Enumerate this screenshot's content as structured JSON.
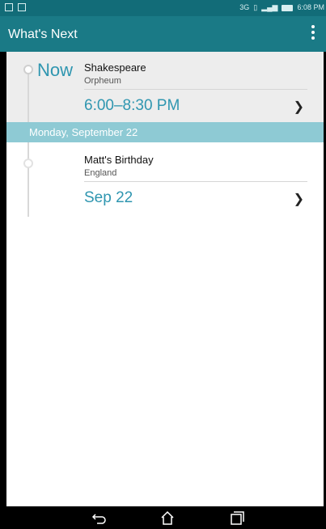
{
  "status_bar": {
    "left_icons": [
      "qs",
      "cc"
    ],
    "time": "6:08 PM"
  },
  "app_bar": {
    "title": "What's Next",
    "overflow_icon": "more-vert-icon"
  },
  "now_section": {
    "label": "Now",
    "event": {
      "title": "Shakespeare",
      "subtitle": "Orpheum",
      "time": "6:00–8:30 PM"
    }
  },
  "day_header": "Monday, September 22",
  "day_events": [
    {
      "title": "Matt's Birthday",
      "subtitle": "England",
      "date": "Sep 22"
    }
  ],
  "colors": {
    "status_bar": "#126c78",
    "app_bar": "#1a7a86",
    "accent": "#2f96b0",
    "date_header": "#8ecad4",
    "now_bg": "#ededed"
  }
}
